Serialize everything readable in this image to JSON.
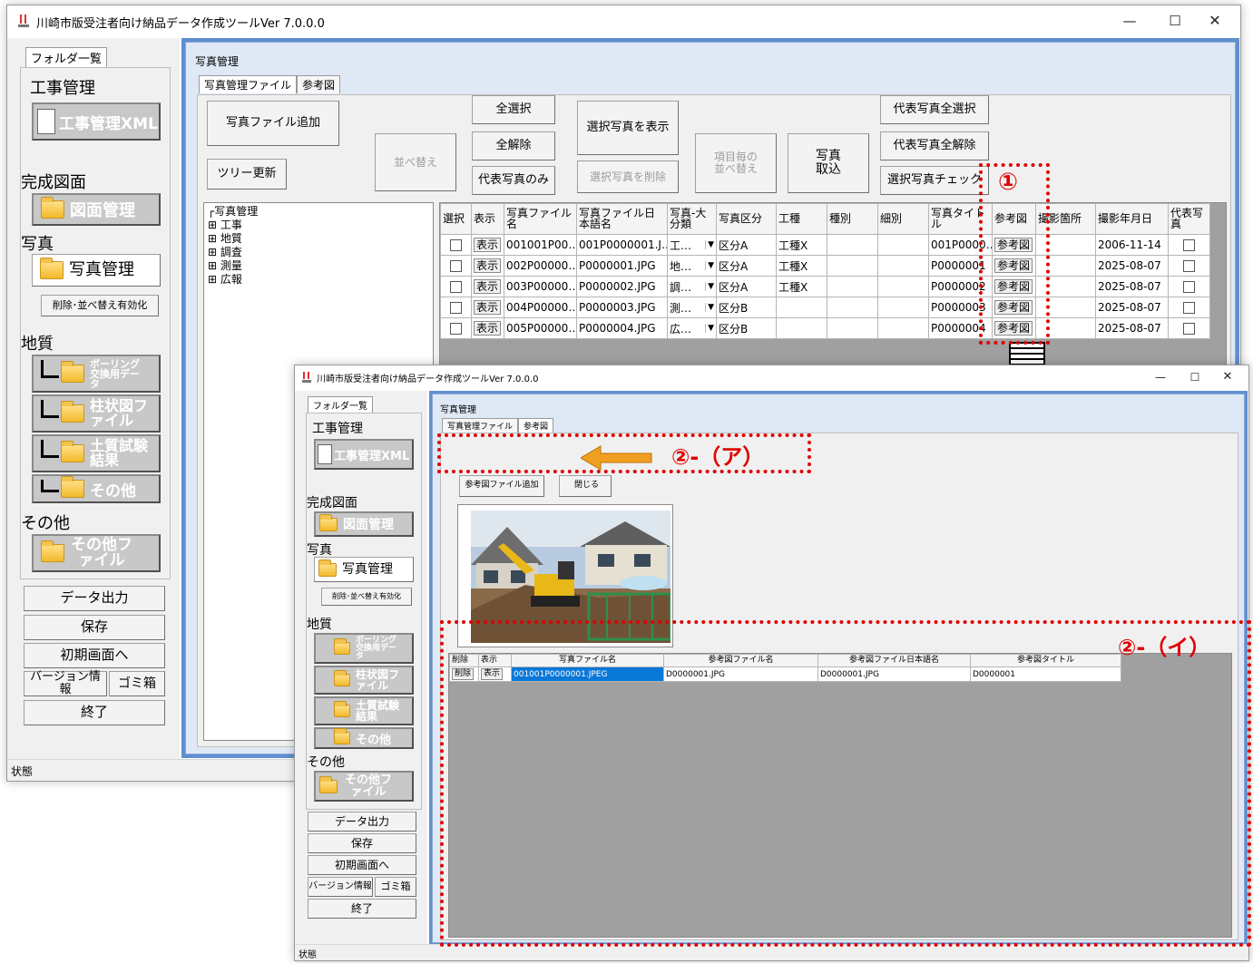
{
  "back_window": {
    "title": "川崎市版受注者向け納品データ作成ツールVer 7.0.0.0",
    "controls": {
      "minimize": "—",
      "maximize": "☐",
      "close": "✕"
    },
    "status": "状態",
    "sidebar": {
      "tab": "フォルダ一覧",
      "sections": {
        "koji": "工事管理",
        "kanse": "完成図面",
        "shashin": "写真",
        "chishitsu": "地質",
        "sonota": "その他"
      },
      "buttons": {
        "xml": "工事管理XML",
        "zumen": "図面管理",
        "shashin": "写真管理",
        "sakujo": "削除･並べ替え有効化",
        "boring": "ボーリング交換用データ",
        "chujo": "柱状図ファイル",
        "dositsu": "土質試験結果",
        "chishitsu_sonota": "その他",
        "sonota_file": "その他ファイル"
      },
      "bottom": {
        "data_out": "データ出力",
        "save": "保存",
        "init": "初期画面へ",
        "version": "バージョン情報",
        "trash": "ゴミ箱",
        "exit": "終了"
      }
    },
    "main": {
      "group": "写真管理",
      "tabs": [
        "写真管理ファイル",
        "参考図"
      ],
      "buttons": {
        "add": "写真ファイル追加",
        "tree_update": "ツリー更新",
        "sort": "並べ替え",
        "select_all": "全選択",
        "deselect_all": "全解除",
        "rep_only": "代表写真のみ",
        "show_selected": "選択写真を表示",
        "delete_selected": "選択写真を削除",
        "item_sort": "項目毎の並べ替え",
        "import": "写真取込",
        "rep_select_all": "代表写真全選択",
        "rep_deselect_all": "代表写真全解除",
        "check_selected": "選択写真チェック"
      },
      "tree": [
        "写真管理",
        "工事",
        "地質",
        "調査",
        "測量",
        "広報"
      ],
      "grid": {
        "headers": [
          "選択",
          "表示",
          "写真ファイル名",
          "写真ファイル日本語名",
          "写真-大分類",
          "写真区分",
          "工種",
          "種別",
          "細別",
          "写真タイトル",
          "参考図",
          "撮影箇所",
          "撮影年月日",
          "代表写真"
        ],
        "rows": [
          {
            "show": "表示",
            "file": "001001P00…",
            "jp": "001P0000001.J…",
            "cat": "工…",
            "kubun": "区分A",
            "koshu": "工種X",
            "title": "001P0000…",
            "ref": "参考図",
            "date": "2006-11-14"
          },
          {
            "show": "表示",
            "file": "002P00000…",
            "jp": "P0000001.JPG",
            "cat": "地…",
            "kubun": "区分A",
            "koshu": "工種X",
            "title": "P0000001",
            "ref": "参考図",
            "date": "2025-08-07"
          },
          {
            "show": "表示",
            "file": "003P00000…",
            "jp": "P0000002.JPG",
            "cat": "調…",
            "kubun": "区分A",
            "koshu": "工種X",
            "title": "P0000002",
            "ref": "参考図",
            "date": "2025-08-07"
          },
          {
            "show": "表示",
            "file": "004P00000…",
            "jp": "P0000003.JPG",
            "cat": "測…",
            "kubun": "区分B",
            "koshu": "",
            "title": "P0000003",
            "ref": "参考図",
            "date": "2025-08-07"
          },
          {
            "show": "表示",
            "file": "005P00000…",
            "jp": "P0000004.JPG",
            "cat": "広…",
            "kubun": "区分B",
            "koshu": "",
            "title": "P0000004",
            "ref": "参考図",
            "date": "2025-08-07"
          }
        ]
      }
    }
  },
  "front_window": {
    "title": "川崎市版受注者向け納品データ作成ツールVer 7.0.0.0",
    "status": "状態",
    "main": {
      "group": "写真管理",
      "tabs": [
        "写真管理ファイル",
        "参考図"
      ],
      "buttons": {
        "add_ref": "参考図ファイル追加",
        "close": "閉じる"
      },
      "grid": {
        "headers": [
          "削除",
          "表示",
          "写真ファイル名",
          "参考図ファイル名",
          "参考図ファイル日本語名",
          "参考図タイトル"
        ],
        "rows": [
          {
            "del": "削除",
            "show": "表示",
            "photo": "001001P0000001.JPEG",
            "ref_file": "D0000001.JPG",
            "ref_jp": "D0000001.JPG",
            "ref_title": "D0000001"
          }
        ]
      }
    }
  },
  "annotations": {
    "one": "①",
    "two_a": "②-（ア）",
    "two_i": "②-（イ）"
  },
  "colors": {
    "annotation": "#e00000",
    "arrow": "#f0a020",
    "selected_cell": "#0a78d7",
    "grid_bg": "#a0a0a0"
  }
}
